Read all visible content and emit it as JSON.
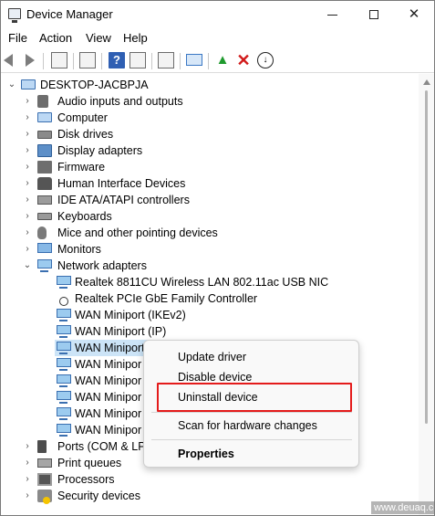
{
  "window": {
    "title": "Device Manager",
    "minimize_icon": "minimize-icon",
    "maximize_icon": "maximize-icon",
    "close_glyph": "✕"
  },
  "menubar": {
    "items": [
      "File",
      "Action",
      "View",
      "Help"
    ]
  },
  "toolbar": {
    "icons": [
      "back-arrow-icon",
      "forward-arrow-icon",
      "properties-grid-icon",
      "device-list-icon",
      "help-icon",
      "view-icon",
      "scan-hardware-icon",
      "monitor-icon",
      "update-driver-icon",
      "uninstall-icon",
      "download-icon"
    ],
    "help_glyph": "?",
    "uninstall_glyph": "✕",
    "download_glyph": "↓",
    "update_glyph": "▲"
  },
  "tree": {
    "root": "DESKTOP-JACBPJA",
    "categories": [
      {
        "label": "Audio inputs and outputs",
        "icon": "speaker-icon"
      },
      {
        "label": "Computer",
        "icon": "computer-icon"
      },
      {
        "label": "Disk drives",
        "icon": "disk-drive-icon"
      },
      {
        "label": "Display adapters",
        "icon": "display-adapter-icon"
      },
      {
        "label": "Firmware",
        "icon": "firmware-chip-icon"
      },
      {
        "label": "Human Interface Devices",
        "icon": "hid-icon"
      },
      {
        "label": "IDE ATA/ATAPI controllers",
        "icon": "ide-controller-icon"
      },
      {
        "label": "Keyboards",
        "icon": "keyboard-icon"
      },
      {
        "label": "Mice and other pointing devices",
        "icon": "mouse-icon"
      },
      {
        "label": "Monitors",
        "icon": "monitor-icon"
      },
      {
        "label": "Network adapters",
        "icon": "network-adapter-icon"
      }
    ],
    "network_children": [
      "Realtek 8811CU Wireless LAN 802.11ac USB NIC",
      "Realtek PCIe GbE Family Controller",
      "WAN Miniport (IKEv2)",
      "WAN Miniport (IP)",
      "WAN Miniport",
      "WAN Minipor",
      "WAN Minipor",
      "WAN Minipor",
      "WAN Minipor",
      "WAN Minipor"
    ],
    "after_categories": [
      {
        "label": "Ports (COM & LPT",
        "icon": "port-icon"
      },
      {
        "label": "Print queues",
        "icon": "printer-icon"
      },
      {
        "label": "Processors",
        "icon": "processor-icon"
      },
      {
        "label": "Security devices",
        "icon": "security-device-icon"
      }
    ],
    "expanded_chevron": "⌄",
    "collapsed_chevron": "›"
  },
  "context_menu": {
    "items": [
      "Update driver",
      "Disable device",
      "Uninstall device",
      "Scan for hardware changes",
      "Properties"
    ]
  },
  "watermark": "www.deuaq.com",
  "colors": {
    "selection": "#cce4f7",
    "highlight_border": "#e41b1b",
    "uninstall_red": "#d11a1a",
    "accent_blue": "#3a6fb0"
  }
}
